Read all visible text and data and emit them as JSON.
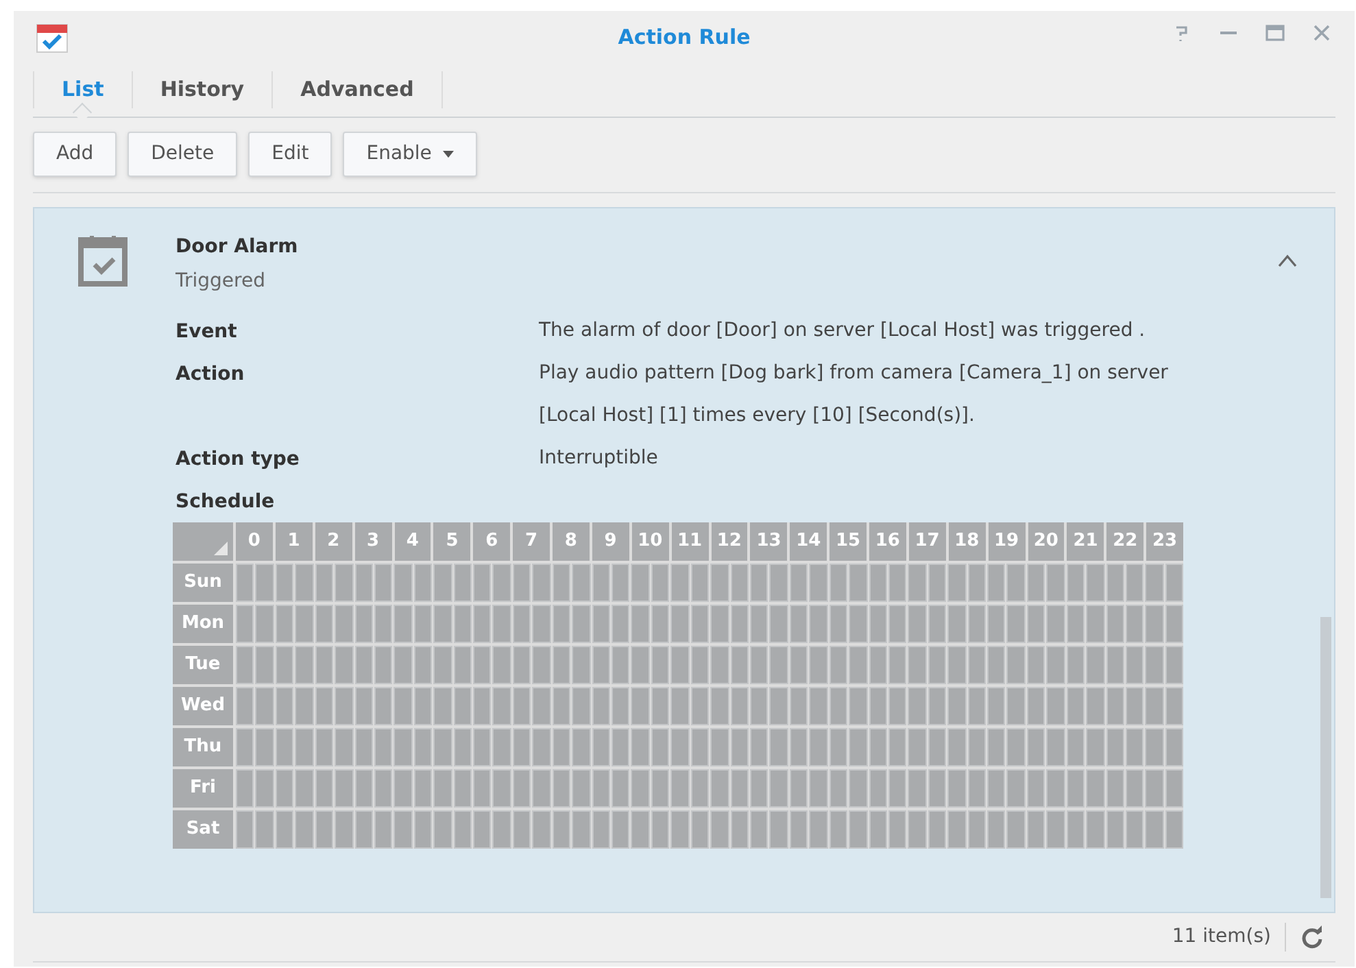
{
  "window": {
    "title": "Action Rule"
  },
  "tabs": [
    {
      "label": "List",
      "selected": true
    },
    {
      "label": "History",
      "selected": false
    },
    {
      "label": "Advanced",
      "selected": false
    }
  ],
  "toolbar": [
    {
      "label": "Add",
      "kind": "plain"
    },
    {
      "label": "Delete",
      "kind": "plain"
    },
    {
      "label": "Edit",
      "kind": "plain"
    },
    {
      "label": "Enable",
      "kind": "dropdown"
    }
  ],
  "rule": {
    "name": "Door Alarm",
    "status": "Triggered",
    "expanded": true,
    "details": [
      {
        "label": "Event",
        "value": "The alarm of door [Door] on server [Local Host] was triggered ."
      },
      {
        "label": "Action",
        "value": "Play audio pattern [Dog bark] from camera [Camera_1] on server [Local Host] [1] times every [10] [Second(s)]."
      },
      {
        "label": "Action type",
        "value": "Interruptible"
      }
    ],
    "schedule": {
      "label": "Schedule",
      "hours": [
        "0",
        "1",
        "2",
        "3",
        "4",
        "5",
        "6",
        "7",
        "8",
        "9",
        "10",
        "11",
        "12",
        "13",
        "14",
        "15",
        "16",
        "17",
        "18",
        "19",
        "20",
        "21",
        "22",
        "23"
      ],
      "days": [
        "Sun",
        "Mon",
        "Tue",
        "Wed",
        "Thu",
        "Fri",
        "Sat"
      ]
    }
  },
  "status_bar": {
    "count": "11 item(s)"
  }
}
